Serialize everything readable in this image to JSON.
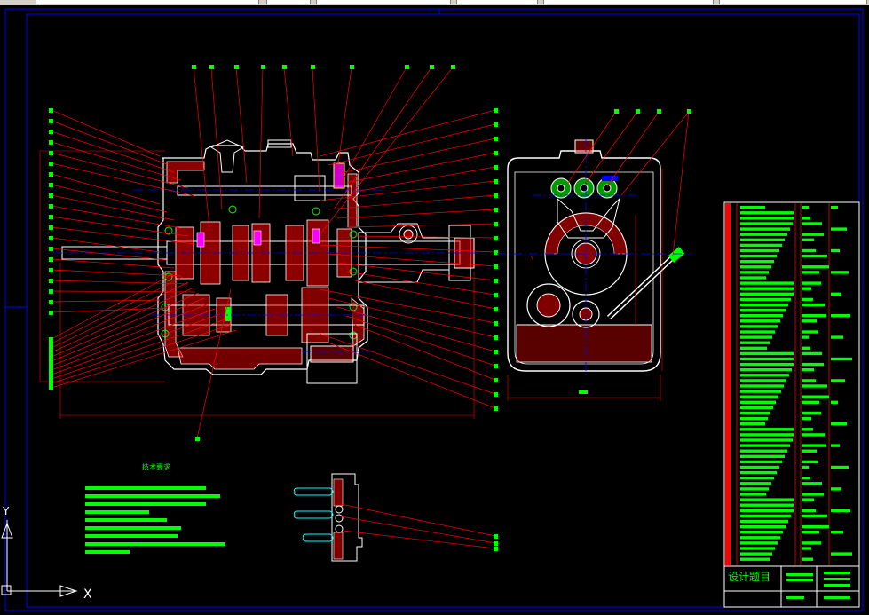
{
  "app": {
    "toolbar_colors": {
      "bg": "#d4d0c8",
      "field": "#ffffff"
    }
  },
  "drawing": {
    "colors": {
      "background": "#000000",
      "frame": "#0000ff",
      "outline": "#ffffff",
      "leader": "#ff0000",
      "label": "#00ff00",
      "hatch": "#ff0000",
      "centerline": "#0000ff",
      "highlight": "#ff00ff",
      "lube": "#00ffff"
    },
    "title_block": {
      "design_title": "设计题目"
    },
    "ucs": {
      "x_label": "X",
      "y_label": "Y"
    },
    "tech_notes_heading": "技术要求"
  }
}
